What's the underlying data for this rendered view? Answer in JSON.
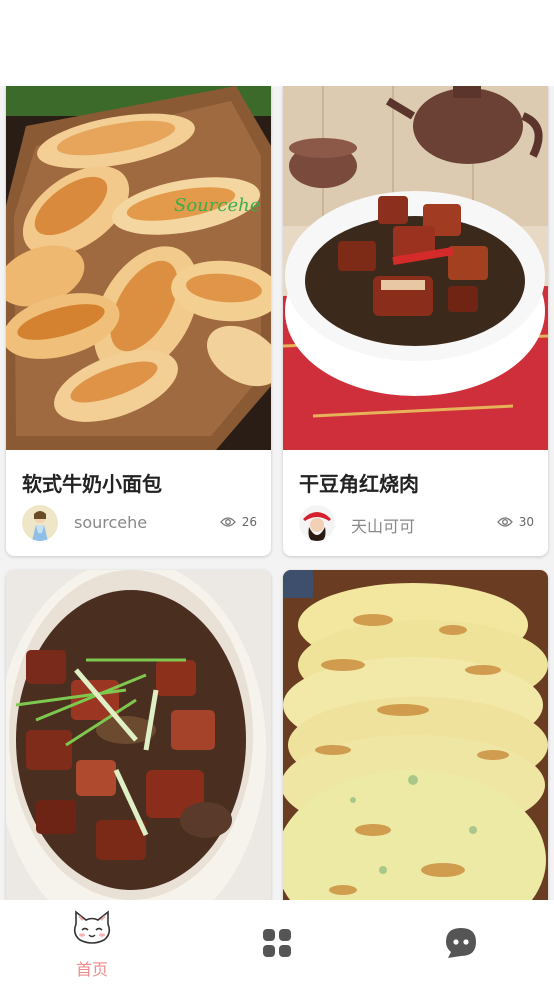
{
  "colors": {
    "accent": "#f08a8a",
    "tab_icon": "#555555",
    "title": "#222222",
    "meta": "#888888"
  },
  "feed": {
    "cards": [
      {
        "title": "软式牛奶小面包",
        "author": "sourcehe",
        "views": "26",
        "watermark": "Sourcehe",
        "photo": "bread-rolls-photo"
      },
      {
        "title": "干豆角红烧肉",
        "author": "天山可可",
        "views": "30",
        "photo": "braised-pork-beans-photo"
      },
      {
        "title": "",
        "author": "",
        "views": "",
        "photo": "braised-pork-clay-pot-photo"
      },
      {
        "title": "",
        "author": "",
        "views": "",
        "photo": "scallion-pancakes-photo"
      }
    ]
  },
  "tabbar": {
    "tabs": [
      {
        "label": "首页",
        "icon": "cat-icon",
        "active": true
      },
      {
        "label": "",
        "icon": "grid-icon",
        "active": false
      },
      {
        "label": "",
        "icon": "chat-icon",
        "active": false
      }
    ]
  }
}
